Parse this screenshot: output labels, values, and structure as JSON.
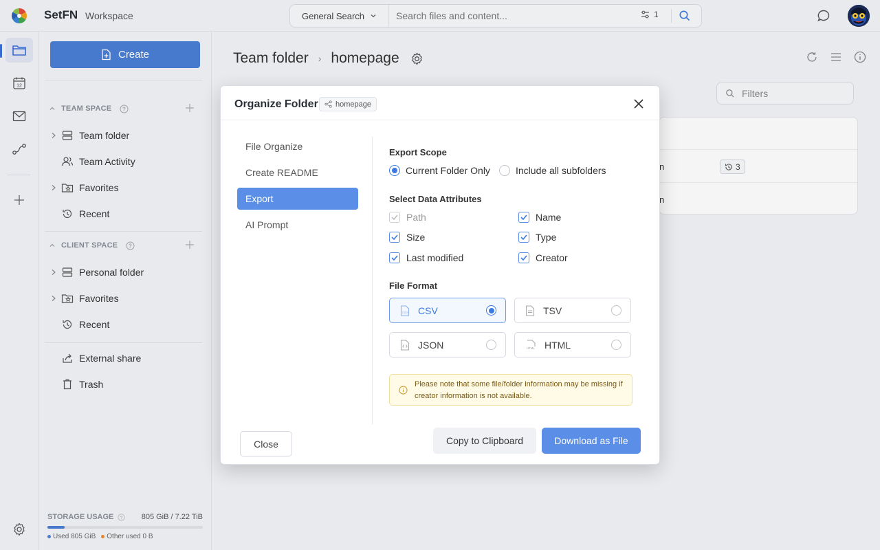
{
  "app": {
    "brand": "SetFN",
    "workspace": "Workspace"
  },
  "search": {
    "type_label": "General Search",
    "placeholder": "Search files and content...",
    "filter_count": "1"
  },
  "rail": {
    "items": [
      "folder-icon",
      "calendar-icon",
      "mail-icon",
      "route-icon",
      "plus-icon",
      "settings-icon"
    ],
    "calendar_day": "12"
  },
  "sidebar": {
    "create_label": "Create",
    "team_space": {
      "title": "TEAM SPACE",
      "items": [
        "Team folder",
        "Team Activity",
        "Favorites",
        "Recent"
      ]
    },
    "client_space": {
      "title": "CLIENT SPACE",
      "items": [
        "Personal folder",
        "Favorites",
        "Recent"
      ]
    },
    "other_items": [
      "External share",
      "Trash"
    ],
    "storage": {
      "title": "STORAGE USAGE",
      "amount": "805 GiB / 7.22 TiB",
      "used_label": "Used 805 GiB",
      "other_label": "Other used 0 B",
      "used_fraction": 0.109
    }
  },
  "main": {
    "breadcrumb": [
      "Team folder",
      "homepage"
    ],
    "filters_placeholder": "Filters",
    "rows": [
      {
        "name_fragment": "n",
        "versions": "3"
      },
      {
        "name_fragment": "n"
      }
    ]
  },
  "modal": {
    "title": "Organize Folder",
    "tag": "homepage",
    "nav": [
      "File Organize",
      "Create README",
      "Export",
      "AI Prompt"
    ],
    "active_nav": "Export",
    "export_scope": {
      "label": "Export Scope",
      "options": [
        "Current Folder Only",
        "Include all subfolders"
      ],
      "selected": "Current Folder Only"
    },
    "attributes": {
      "label": "Select Data Attributes",
      "items": [
        {
          "name": "Path",
          "checked": true,
          "disabled": true
        },
        {
          "name": "Name",
          "checked": true
        },
        {
          "name": "Size",
          "checked": true
        },
        {
          "name": "Type",
          "checked": true
        },
        {
          "name": "Last modified",
          "checked": true
        },
        {
          "name": "Creator",
          "checked": true
        }
      ]
    },
    "file_format": {
      "label": "File Format",
      "options": [
        {
          "name": "CSV",
          "icon_text": "CSV"
        },
        {
          "name": "TSV",
          "icon_text": ""
        },
        {
          "name": "JSON",
          "icon_text": ""
        },
        {
          "name": "HTML",
          "icon_text": "HTML"
        }
      ],
      "selected": "CSV"
    },
    "notice": "Please note that some file/folder information may be missing if creator information is not available.",
    "buttons": {
      "close": "Close",
      "copy": "Copy to Clipboard",
      "download": "Download as File"
    }
  },
  "colors": {
    "accent": "#5b8ee6",
    "primary": "#4a7fd6",
    "notice_bg": "#fffbe6"
  }
}
